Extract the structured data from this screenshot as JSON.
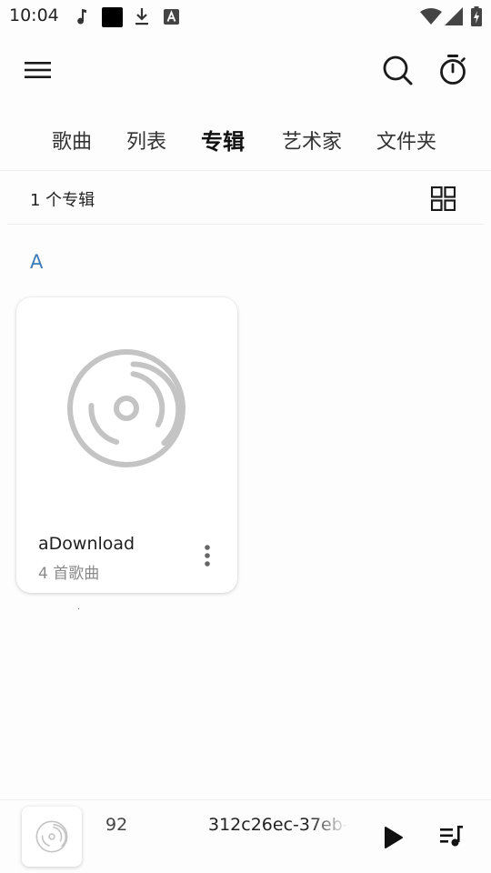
{
  "status_bar": {
    "time": "10:04",
    "left_icons": [
      "music-note-icon",
      "black-square-icon",
      "download-icon",
      "a-badge-icon"
    ],
    "right_icons": [
      "wifi-icon",
      "signal-icon",
      "battery-charging-icon"
    ]
  },
  "app_bar": {
    "menu_icon": "menu-icon",
    "search_icon": "search-icon",
    "timer_icon": "timer-icon"
  },
  "tabs": [
    {
      "label": "歌曲",
      "active": false
    },
    {
      "label": "列表",
      "active": false
    },
    {
      "label": "专辑",
      "active": true
    },
    {
      "label": "艺术家",
      "active": false
    },
    {
      "label": "文件夹",
      "active": false
    }
  ],
  "list_header": {
    "count_text": "1 个专辑",
    "view_toggle_icon": "grid-view-icon"
  },
  "section": {
    "letter": "A"
  },
  "albums": [
    {
      "title": "aDownload",
      "subtitle": "4 首歌曲",
      "art_icon": "disc-icon",
      "menu_icon": "more-vert-icon"
    }
  ],
  "mini_player": {
    "art_icon": "disc-icon",
    "text_left": "92",
    "text_right": "312c26ec-37eb-",
    "play_icon": "play-icon",
    "queue_icon": "queue-music-icon"
  },
  "colors": {
    "accent": "#3d7bb8",
    "icon_dark": "#1a1a1a",
    "disc_gray": "#c4c4c4"
  }
}
